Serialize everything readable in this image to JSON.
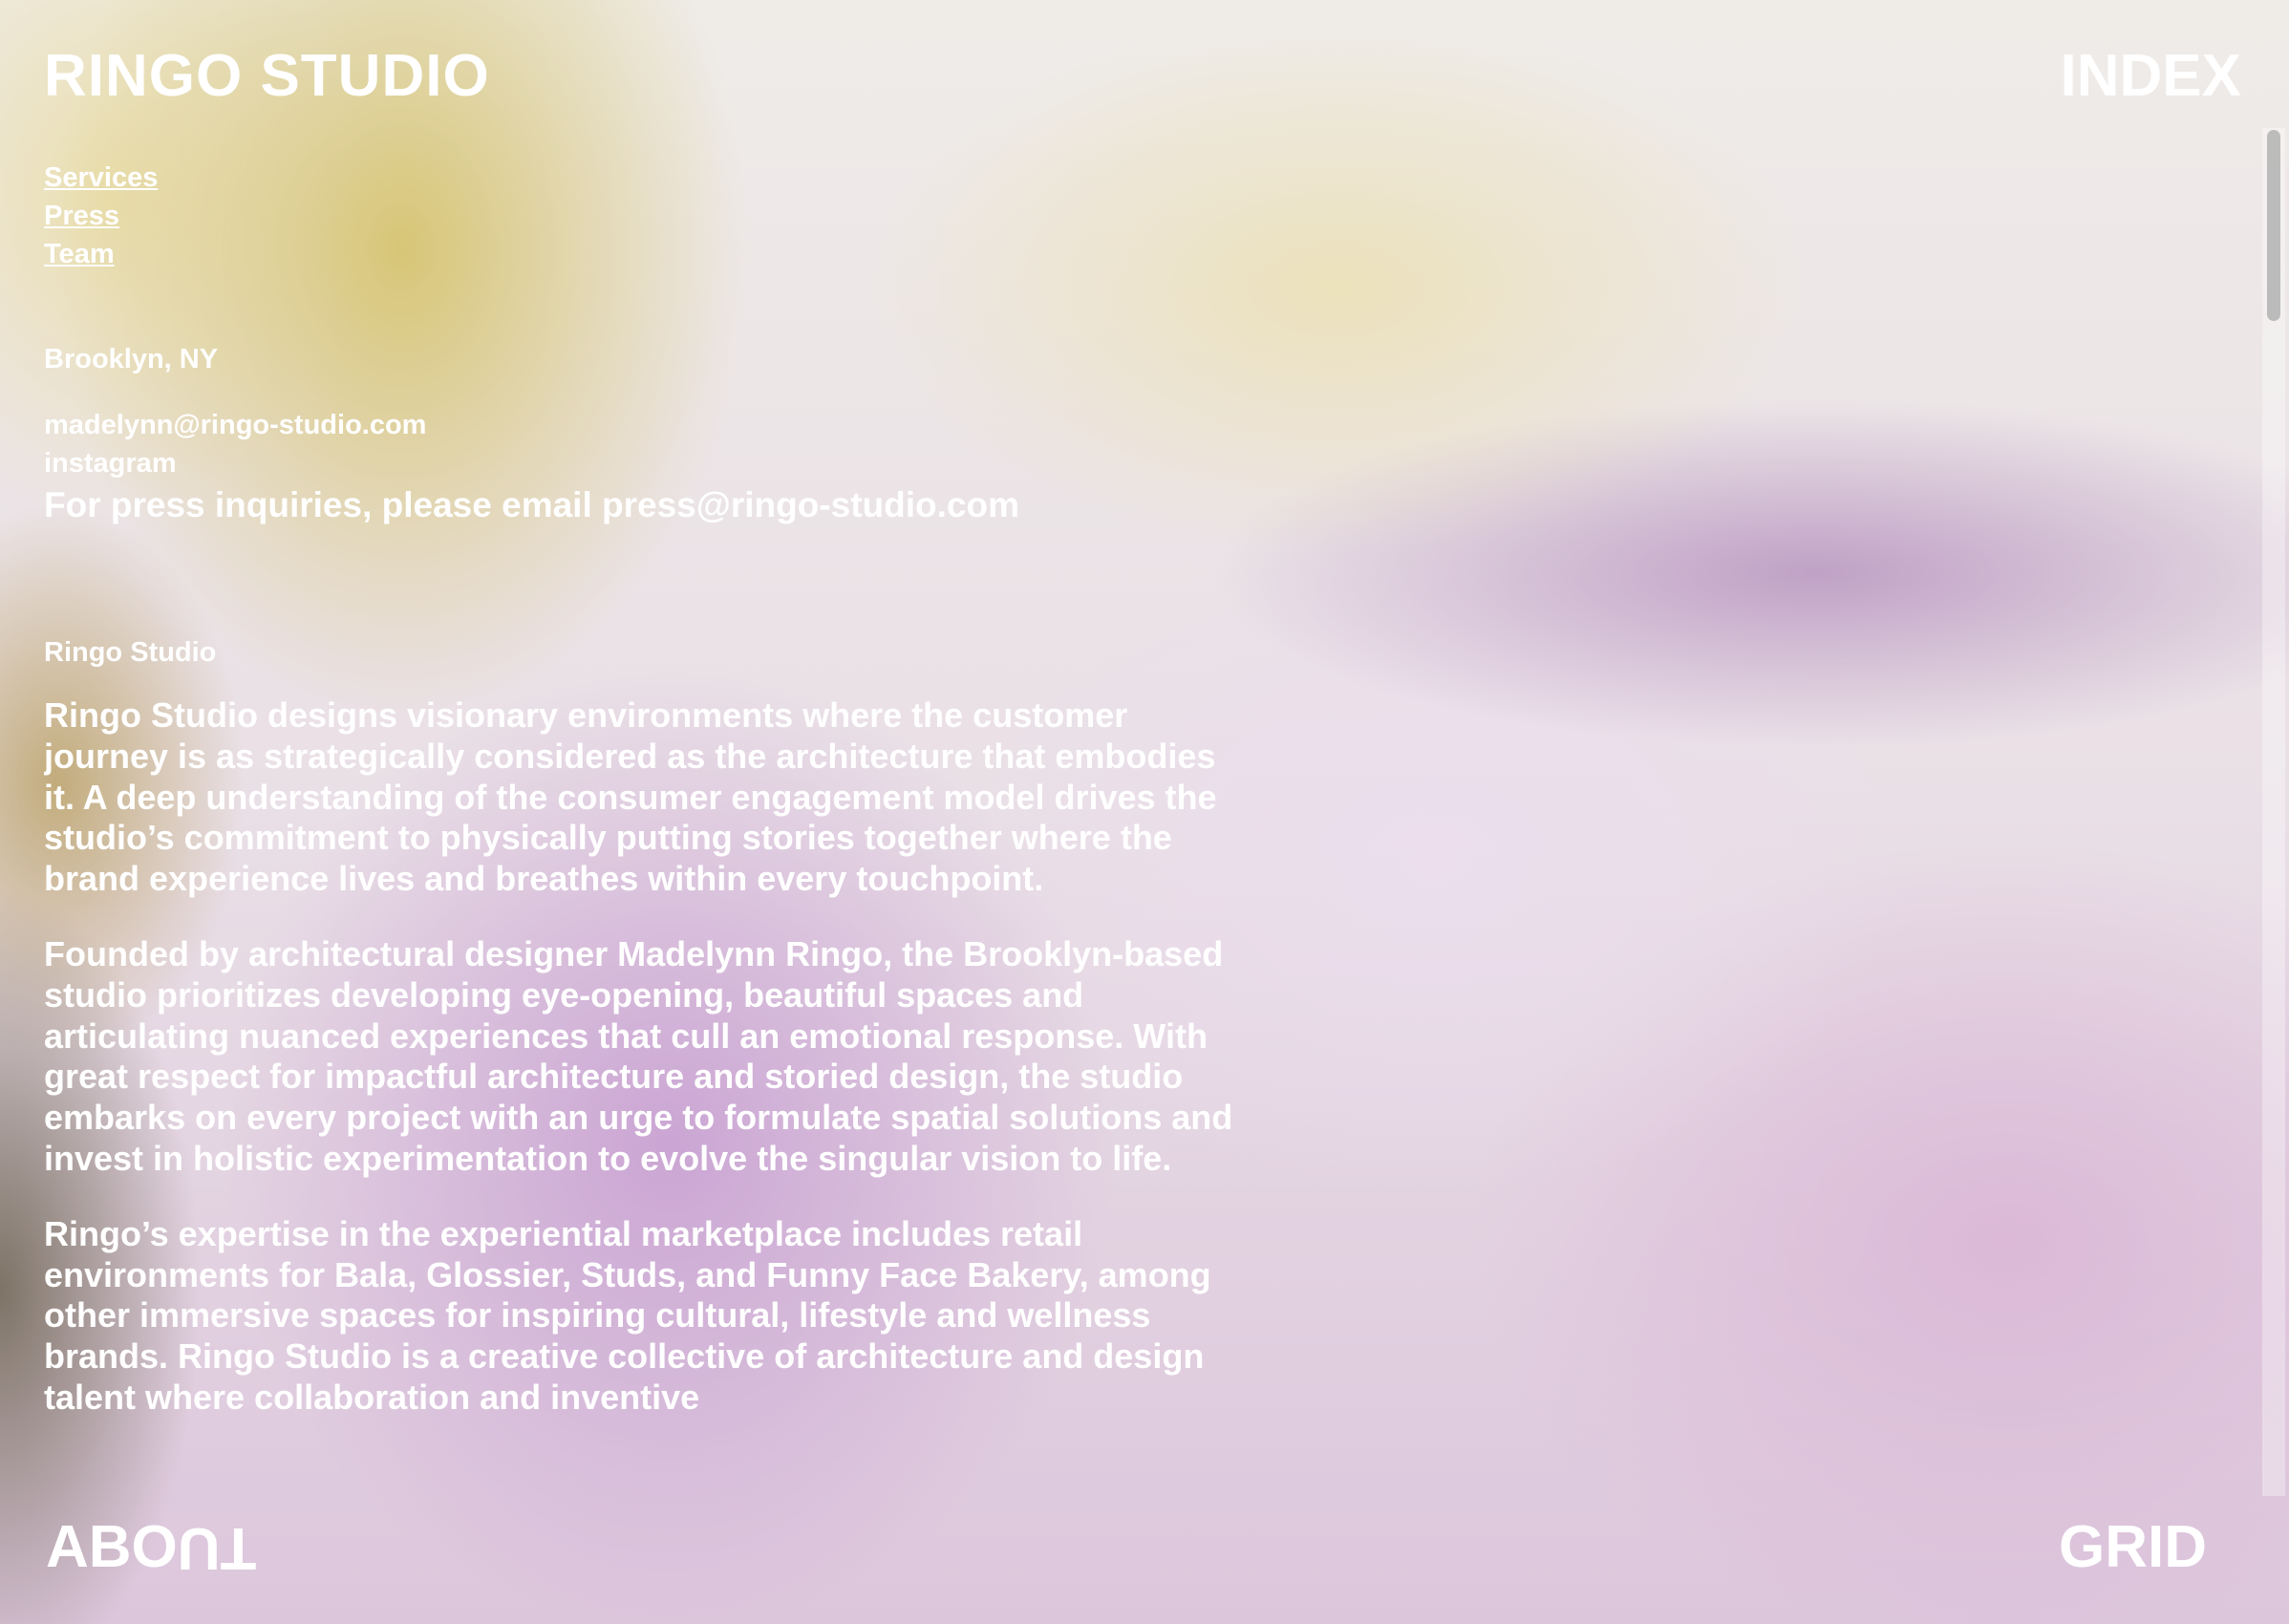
{
  "header": {
    "brand": "RINGO STUDIO",
    "index_label": "INDEX"
  },
  "nav": {
    "items": [
      {
        "label": "Services"
      },
      {
        "label": "Press"
      },
      {
        "label": "Team"
      }
    ]
  },
  "location": "Brooklyn, NY",
  "contact": {
    "email": "madelynn@ringo-studio.com",
    "instagram": "instagram",
    "press_note": "For press inquiries, please email press@ringo-studio.com"
  },
  "about": {
    "heading": "Ringo Studio",
    "paragraphs": [
      "Ringo Studio designs visionary environments where the customer journey is as strategically considered as the architecture that embodies it. A deep understanding of the consumer engagement model drives the studio’s commitment to physically putting stories together where the brand experience lives and breathes within every touchpoint.",
      "Founded by architectural designer Madelynn Ringo, the Brooklyn-based studio prioritizes developing eye-opening, beautiful spaces and articulating nuanced experiences that cull an emotional response. With great respect for impactful architecture and storied design, the studio embarks on every project with an urge to formulate spatial solutions and invest in holistic experimentation to evolve the singular vision to life.",
      "Ringo’s expertise in the experiential marketplace includes retail environments for Bala, Glossier, Studs, and Funny Face Bakery, among other immersive spaces for inspiring cultural, lifestyle and wellness brands. Ringo Studio is a creative collective of architecture and design talent where collaboration and inventive"
    ]
  },
  "footer": {
    "about_prefix": "ABO",
    "about_flipped": "UT",
    "grid_label": "GRID"
  }
}
